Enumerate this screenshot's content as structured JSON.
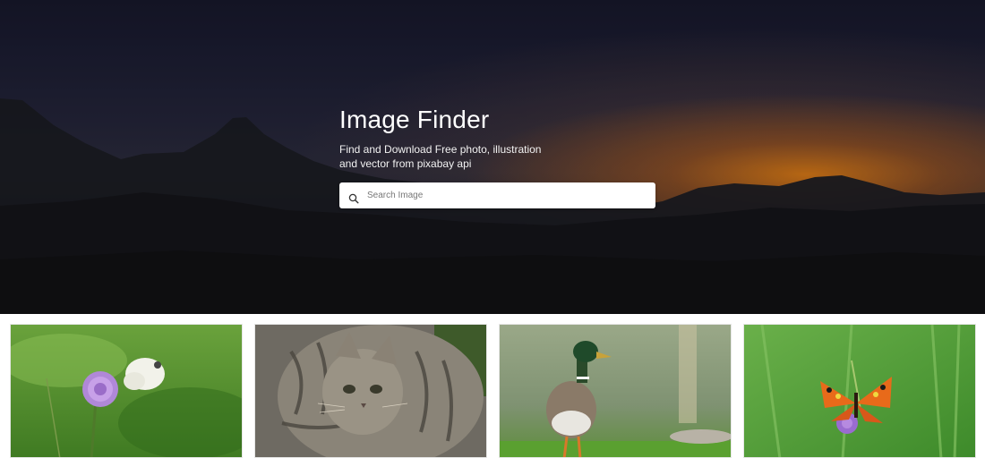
{
  "hero": {
    "title": "Image Finder",
    "subtitle": "Find and Download Free photo, illustration and vector from pixabay api"
  },
  "search": {
    "placeholder": "Search Image",
    "value": "",
    "icon": "search-icon"
  },
  "gallery": {
    "images": [
      {
        "subject": "butterfly-on-flower"
      },
      {
        "subject": "tabby-cat"
      },
      {
        "subject": "mallard-duck"
      },
      {
        "subject": "orange-butterfly"
      }
    ]
  },
  "colors": {
    "hero_sky": "#1f2035",
    "hero_sunset": "#d87814",
    "search_bg": "#ffffff",
    "page_bg": "#ffffff"
  }
}
